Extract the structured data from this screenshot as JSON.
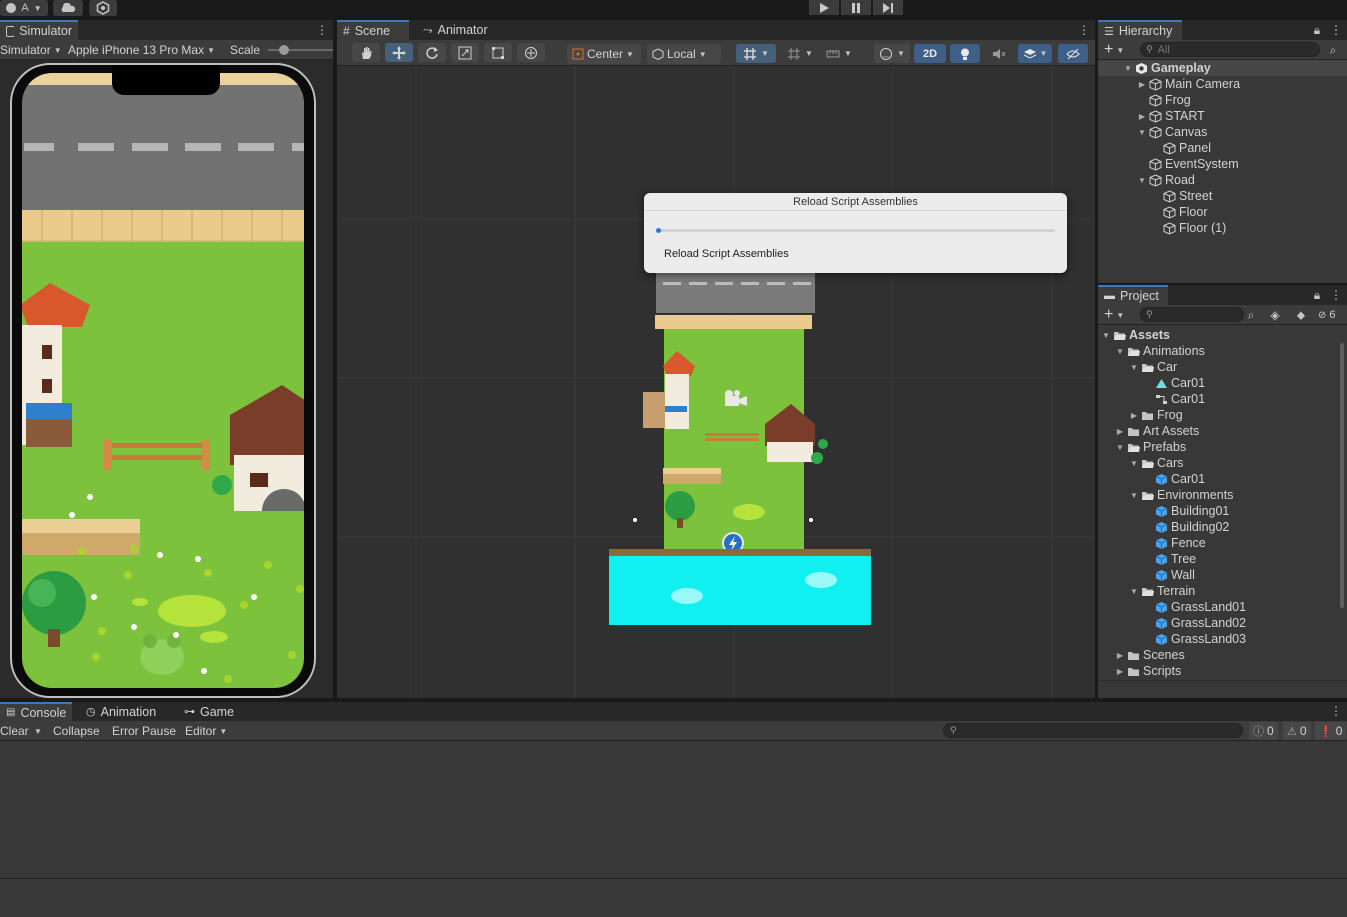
{
  "topbar": {
    "account_label": "A",
    "play_controls": [
      "play-icon",
      "pause-icon",
      "step-icon"
    ]
  },
  "simulator": {
    "tab_label": "Simulator",
    "mode_select": "Simulator",
    "device_select": "Apple iPhone 13 Pro Max",
    "scale_label": "Scale"
  },
  "scene": {
    "tabs": [
      {
        "label": "Scene",
        "icon": "grid-icon"
      },
      {
        "label": "Animator",
        "icon": "animator-icon"
      }
    ],
    "pivot_select": "Center",
    "space_select": "Local",
    "mode_2d_label": "2D"
  },
  "dialog": {
    "title": "Reload Script Assemblies",
    "progress": 0.01,
    "status_text": "Reload Script Assemblies"
  },
  "hierarchy": {
    "tab_label": "Hierarchy",
    "search_placeholder": "All",
    "items": [
      {
        "label": "Gameplay",
        "depth": 0,
        "expand": "open",
        "type": "scene",
        "bold": true
      },
      {
        "label": "Main Camera",
        "depth": 1,
        "expand": "closed",
        "type": "object"
      },
      {
        "label": "Frog",
        "depth": 1,
        "expand": "none",
        "type": "object"
      },
      {
        "label": "START",
        "depth": 1,
        "expand": "closed",
        "type": "object"
      },
      {
        "label": "Canvas",
        "depth": 1,
        "expand": "open",
        "type": "object"
      },
      {
        "label": "Panel",
        "depth": 2,
        "expand": "none",
        "type": "object"
      },
      {
        "label": "EventSystem",
        "depth": 1,
        "expand": "none",
        "type": "object"
      },
      {
        "label": "Road",
        "depth": 1,
        "expand": "open",
        "type": "object"
      },
      {
        "label": "Street",
        "depth": 2,
        "expand": "none",
        "type": "object"
      },
      {
        "label": "Floor",
        "depth": 2,
        "expand": "none",
        "type": "object"
      },
      {
        "label": "Floor (1)",
        "depth": 2,
        "expand": "none",
        "type": "object"
      }
    ]
  },
  "project": {
    "tab_label": "Project",
    "hidden_count": "6",
    "items": [
      {
        "label": "Assets",
        "depth": 0,
        "expand": "open",
        "type": "folder-open",
        "bold": true
      },
      {
        "label": "Animations",
        "depth": 1,
        "expand": "open",
        "type": "folder-open"
      },
      {
        "label": "Car",
        "depth": 2,
        "expand": "open",
        "type": "folder-open"
      },
      {
        "label": "Car01",
        "depth": 3,
        "expand": "none",
        "type": "anim-clip"
      },
      {
        "label": "Car01",
        "depth": 3,
        "expand": "none",
        "type": "animator"
      },
      {
        "label": "Frog",
        "depth": 2,
        "expand": "closed",
        "type": "folder"
      },
      {
        "label": "Art Assets",
        "depth": 1,
        "expand": "closed",
        "type": "folder"
      },
      {
        "label": "Prefabs",
        "depth": 1,
        "expand": "open",
        "type": "folder-open"
      },
      {
        "label": "Cars",
        "depth": 2,
        "expand": "open",
        "type": "folder-open"
      },
      {
        "label": "Car01",
        "depth": 3,
        "expand": "none",
        "type": "prefab"
      },
      {
        "label": "Environments",
        "depth": 2,
        "expand": "open",
        "type": "folder-open"
      },
      {
        "label": "Building01",
        "depth": 3,
        "expand": "none",
        "type": "prefab"
      },
      {
        "label": "Building02",
        "depth": 3,
        "expand": "none",
        "type": "prefab"
      },
      {
        "label": "Fence",
        "depth": 3,
        "expand": "none",
        "type": "prefab"
      },
      {
        "label": "Tree",
        "depth": 3,
        "expand": "none",
        "type": "prefab"
      },
      {
        "label": "Wall",
        "depth": 3,
        "expand": "none",
        "type": "prefab"
      },
      {
        "label": "Terrain",
        "depth": 2,
        "expand": "open",
        "type": "folder-open"
      },
      {
        "label": "GrassLand01",
        "depth": 3,
        "expand": "none",
        "type": "prefab"
      },
      {
        "label": "GrassLand02",
        "depth": 3,
        "expand": "none",
        "type": "prefab"
      },
      {
        "label": "GrassLand03",
        "depth": 3,
        "expand": "none",
        "type": "prefab"
      },
      {
        "label": "Scenes",
        "depth": 1,
        "expand": "closed",
        "type": "folder"
      },
      {
        "label": "Scripts",
        "depth": 1,
        "expand": "closed",
        "type": "folder"
      }
    ]
  },
  "console": {
    "tabs": [
      {
        "label": "Console",
        "icon": "console-icon"
      },
      {
        "label": "Animation",
        "icon": "clock-icon"
      },
      {
        "label": "Game",
        "icon": "gamepad-icon"
      }
    ],
    "clear_label": "Clear",
    "collapse_label": "Collapse",
    "error_pause_label": "Error Pause",
    "editor_label": "Editor",
    "log_count": "0",
    "warning_count": "0",
    "error_count": "0"
  },
  "colors": {
    "accent": "#3a79bb",
    "grass": "#7dc23c",
    "water": "#10f0f0",
    "road": "#6f6f6f",
    "panel": "#383838"
  }
}
